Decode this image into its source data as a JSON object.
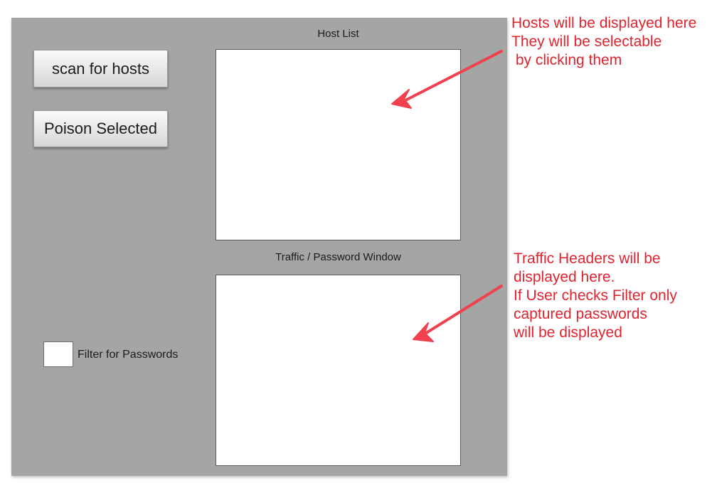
{
  "buttons": {
    "scan_label": "scan for hosts",
    "poison_label": "Poison Selected"
  },
  "host_list": {
    "title": "Host List",
    "items": []
  },
  "traffic_window": {
    "title": "Traffic / Password Window",
    "items": []
  },
  "filter": {
    "label": "Filter for Passwords",
    "checked": false
  },
  "annotations": {
    "hosts_note": "Hosts will be displayed here\nThey will be selectable\n by clicking them",
    "traffic_note": "Traffic Headers will be\ndisplayed here.\nIf User checks Filter only\ncaptured passwords\nwill be displayed"
  },
  "colors": {
    "panel_background": "#a4a6a5",
    "annotation_red": "#e0242f",
    "arrow_red": "#f0414e"
  }
}
